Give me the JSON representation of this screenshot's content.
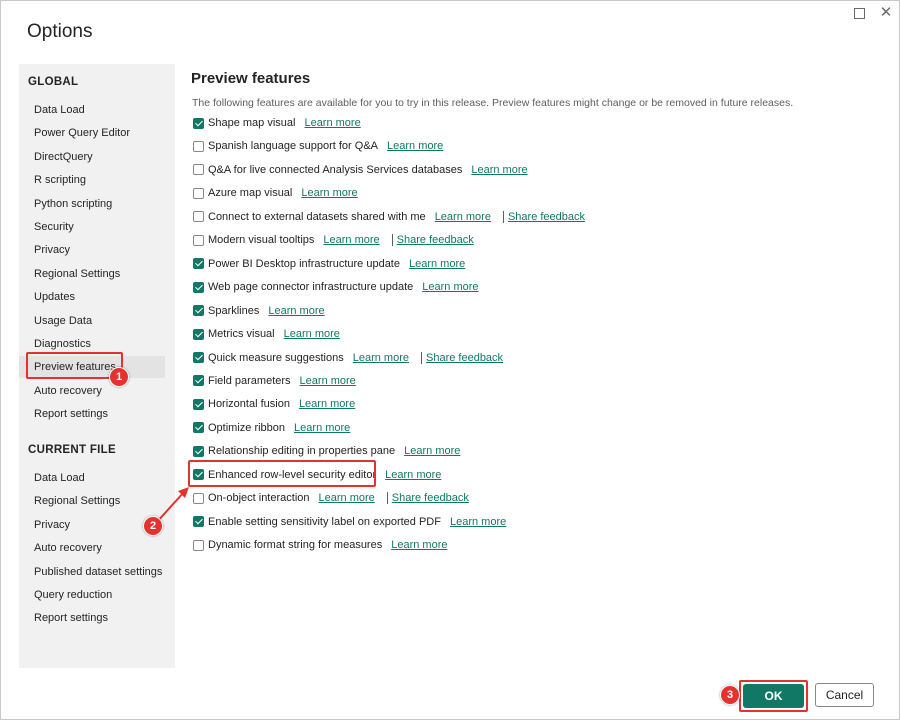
{
  "dialog": {
    "title": "Options"
  },
  "sidebar": {
    "global_heading": "GLOBAL",
    "global_items": [
      {
        "label": "Data Load"
      },
      {
        "label": "Power Query Editor"
      },
      {
        "label": "DirectQuery"
      },
      {
        "label": "R scripting"
      },
      {
        "label": "Python scripting"
      },
      {
        "label": "Security"
      },
      {
        "label": "Privacy"
      },
      {
        "label": "Regional Settings"
      },
      {
        "label": "Updates"
      },
      {
        "label": "Usage Data"
      },
      {
        "label": "Diagnostics"
      },
      {
        "label": "Preview features",
        "selected": true
      },
      {
        "label": "Auto recovery"
      },
      {
        "label": "Report settings"
      }
    ],
    "current_heading": "CURRENT FILE",
    "current_items": [
      {
        "label": "Data Load"
      },
      {
        "label": "Regional Settings"
      },
      {
        "label": "Privacy"
      },
      {
        "label": "Auto recovery"
      },
      {
        "label": "Published dataset settings"
      },
      {
        "label": "Query reduction"
      },
      {
        "label": "Report settings"
      }
    ]
  },
  "main": {
    "title": "Preview features",
    "description": "The following features are available for you to try in this release. Preview features might change or be removed in future releases.",
    "learn_more": "Learn more",
    "share_feedback": "Share feedback",
    "features": [
      {
        "label": "Shape map visual",
        "checked": true,
        "feedback": false
      },
      {
        "label": "Spanish language support for Q&A",
        "checked": false,
        "feedback": false
      },
      {
        "label": "Q&A for live connected Analysis Services databases",
        "checked": false,
        "feedback": false
      },
      {
        "label": "Azure map visual",
        "checked": false,
        "feedback": false
      },
      {
        "label": "Connect to external datasets shared with me",
        "checked": false,
        "feedback": true
      },
      {
        "label": "Modern visual tooltips",
        "checked": false,
        "feedback": true
      },
      {
        "label": "Power BI Desktop infrastructure update",
        "checked": true,
        "feedback": false
      },
      {
        "label": "Web page connector infrastructure update",
        "checked": true,
        "feedback": false
      },
      {
        "label": "Sparklines",
        "checked": true,
        "feedback": false
      },
      {
        "label": "Metrics visual",
        "checked": true,
        "feedback": false
      },
      {
        "label": "Quick measure suggestions",
        "checked": true,
        "feedback": true
      },
      {
        "label": "Field parameters",
        "checked": true,
        "feedback": false
      },
      {
        "label": "Horizontal fusion",
        "checked": true,
        "feedback": false
      },
      {
        "label": "Optimize ribbon",
        "checked": true,
        "feedback": false
      },
      {
        "label": "Relationship editing in properties pane",
        "checked": true,
        "feedback": false
      },
      {
        "label": "Enhanced row-level security editor",
        "checked": true,
        "feedback": false
      },
      {
        "label": "On-object interaction",
        "checked": false,
        "feedback": true
      },
      {
        "label": "Enable setting sensitivity label on exported PDF",
        "checked": true,
        "feedback": false
      },
      {
        "label": "Dynamic format string for measures",
        "checked": false,
        "feedback": false
      }
    ]
  },
  "buttons": {
    "ok": "OK",
    "cancel": "Cancel"
  },
  "annotations": {
    "step1": "1",
    "step2": "2",
    "step3": "3",
    "color": "#e2332f"
  },
  "colors": {
    "accent": "#117865"
  }
}
